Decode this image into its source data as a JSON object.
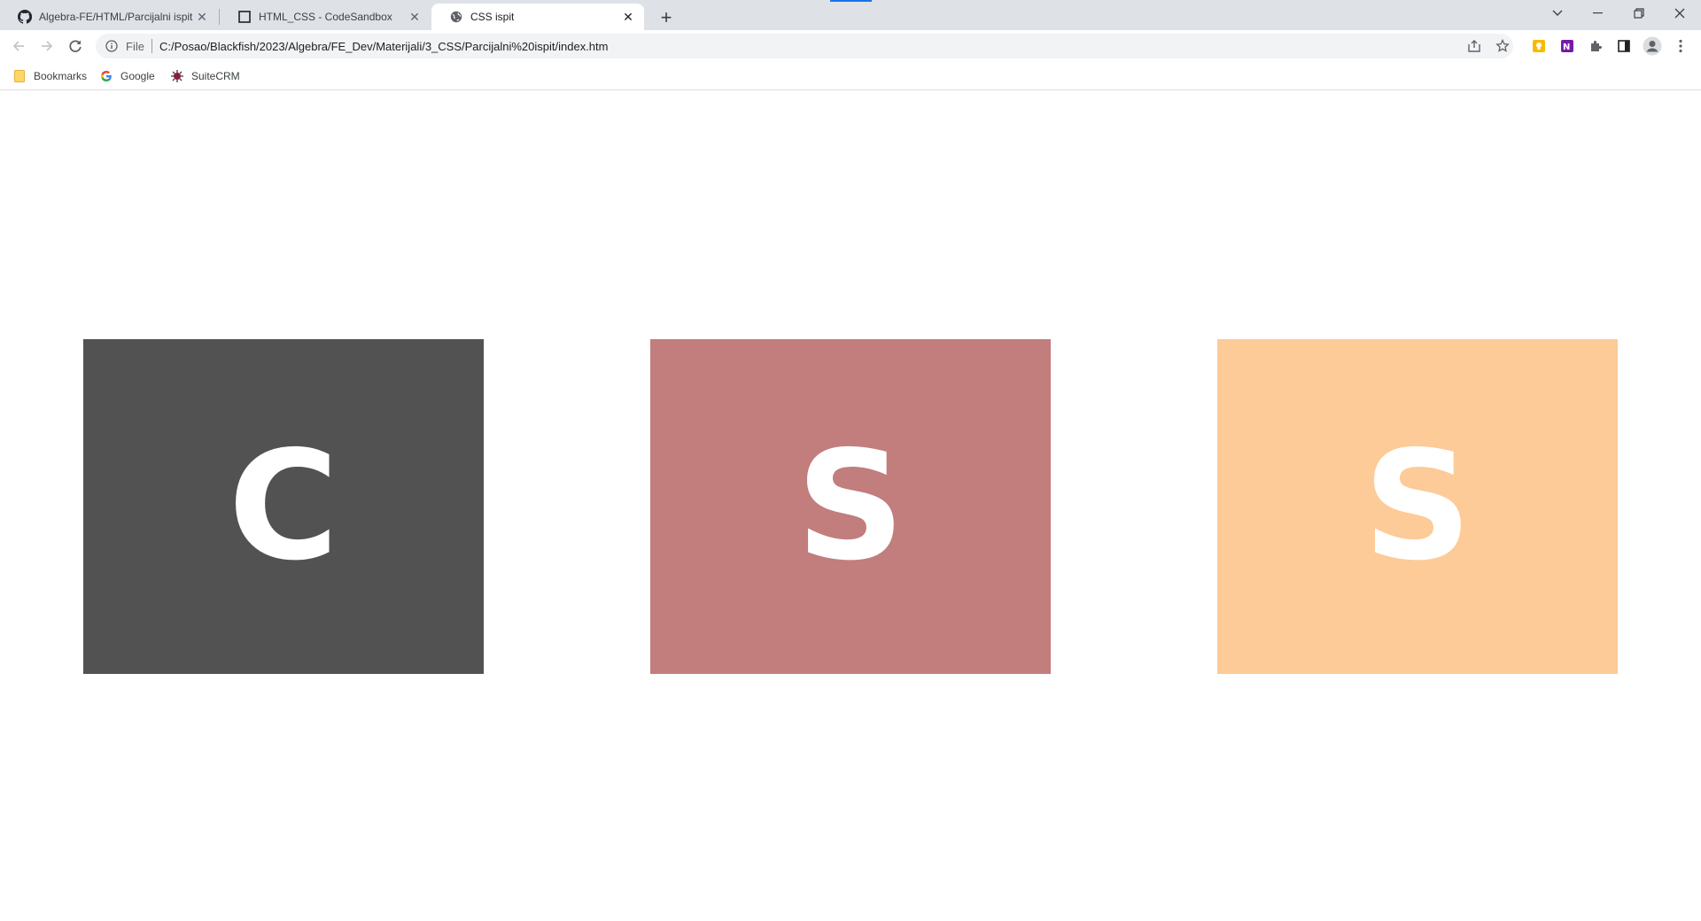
{
  "browser": {
    "tabs": [
      {
        "title": "Algebra-FE/HTML/Parcijalni ispit",
        "icon": "github-icon",
        "active": false
      },
      {
        "title": "HTML_CSS - CodeSandbox",
        "icon": "codesandbox-icon",
        "active": false
      },
      {
        "title": "CSS ispit",
        "icon": "globe-icon",
        "active": true
      }
    ],
    "address": {
      "scheme_label": "File",
      "url": "C:/Posao/Blackfish/2023/Algebra/FE_Dev/Materijali/3_CSS/Parcijalni%20ispit/index.htm"
    },
    "bookmarks": [
      {
        "label": "Bookmarks",
        "icon": "folder-icon"
      },
      {
        "label": "Google",
        "icon": "google-icon"
      },
      {
        "label": "SuiteCRM",
        "icon": "suitecrm-icon"
      }
    ]
  },
  "content": {
    "boxes": [
      {
        "letter": "C",
        "color": "#525252"
      },
      {
        "letter": "S",
        "color": "#c27d7d"
      },
      {
        "letter": "S",
        "color": "#fccb98"
      }
    ]
  }
}
